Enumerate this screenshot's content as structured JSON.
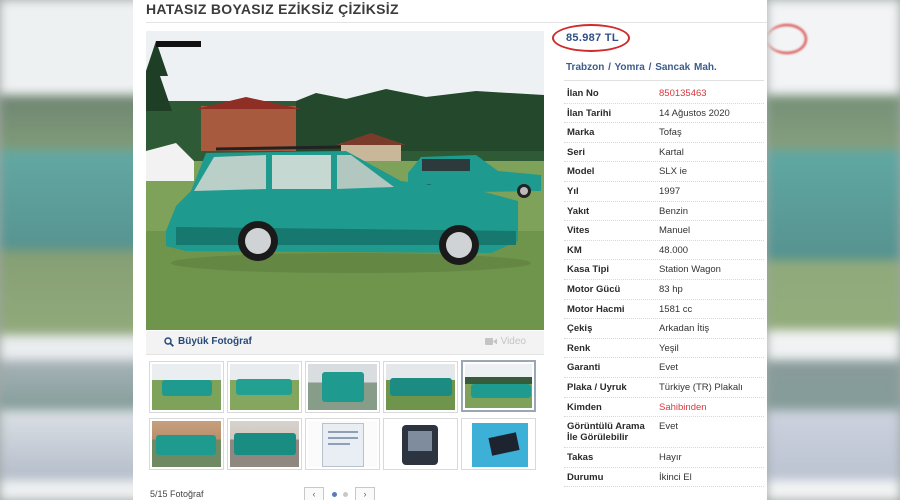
{
  "listing": {
    "title": "HATASIZ BOYASIZ EZİKSİZ ÇİZİKSİZ",
    "price": "85.987 TL",
    "location": "Trabzon  /  Yomra  /  Sancak Mah.",
    "details": [
      {
        "key": "İlan No",
        "value": "850135463",
        "highlight": true
      },
      {
        "key": "İlan Tarihi",
        "value": "14 Ağustos 2020"
      },
      {
        "key": "Marka",
        "value": "Tofaş"
      },
      {
        "key": "Seri",
        "value": "Kartal"
      },
      {
        "key": "Model",
        "value": "SLX ie"
      },
      {
        "key": "Yıl",
        "value": "1997"
      },
      {
        "key": "Yakıt",
        "value": "Benzin"
      },
      {
        "key": "Vites",
        "value": "Manuel"
      },
      {
        "key": "KM",
        "value": "48.000"
      },
      {
        "key": "Kasa Tipi",
        "value": "Station Wagon"
      },
      {
        "key": "Motor Gücü",
        "value": "83 hp"
      },
      {
        "key": "Motor Hacmi",
        "value": "1581 cc"
      },
      {
        "key": "Çekiş",
        "value": "Arkadan İtiş"
      },
      {
        "key": "Renk",
        "value": "Yeşil"
      },
      {
        "key": "Garanti",
        "value": "Evet"
      },
      {
        "key": "Plaka / Uyruk",
        "value": "Türkiye (TR) Plakalı"
      },
      {
        "key": "Kimden",
        "value": "Sahibinden",
        "highlight": true
      },
      {
        "key": "Görüntülü Arama İle Görülebilir",
        "value": "Evet"
      },
      {
        "key": "Takas",
        "value": "Hayır"
      },
      {
        "key": "Durumu",
        "value": "İkinci El"
      }
    ]
  },
  "gallery": {
    "big_photo_label": "Büyük Fotoğraf",
    "video_label": "Video",
    "counter": "5/15 Fotoğraf",
    "prev_symbol": "‹",
    "next_symbol": "›",
    "active_index": 5
  },
  "icons": {
    "magnifier": "search-icon",
    "video": "video-camera-icon"
  },
  "colors": {
    "car_teal": "#1f9a8e",
    "price_circle": "#cf2b2b",
    "link_blue": "#2e4f8a",
    "highlight_red": "#d6383e"
  }
}
